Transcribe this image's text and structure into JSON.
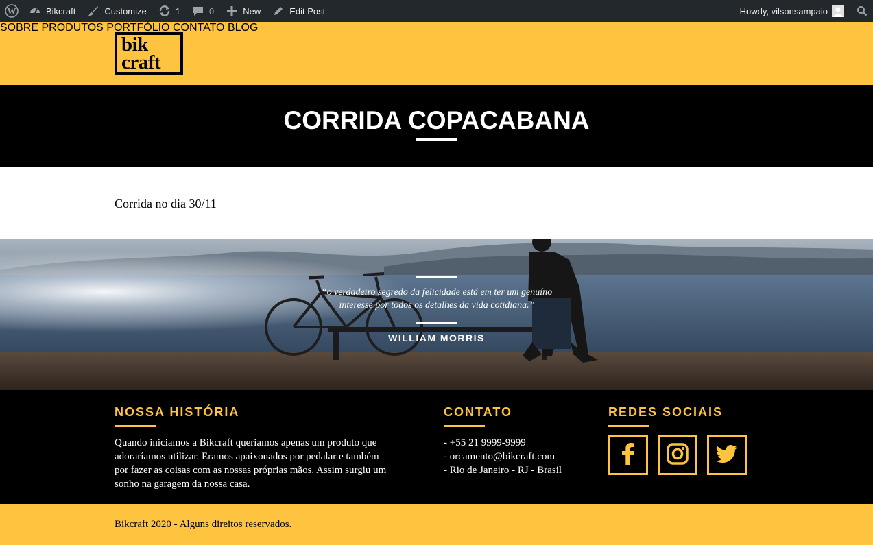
{
  "adminbar": {
    "site_name": "Bikcraft",
    "customize": "Customize",
    "updates_count": "1",
    "comments_count": "0",
    "new_label": "New",
    "edit_post": "Edit Post",
    "howdy": "Howdy, vilsonsampaio"
  },
  "header": {
    "logo_line1": "bik",
    "logo_line2": "craft",
    "nav": [
      "SOBRE",
      "PRODUTOS",
      "PORTFÓLIO",
      "CONTATO",
      "BLOG"
    ]
  },
  "page": {
    "title": "CORRIDA COPACABANA",
    "content": "Corrida no dia 30/11"
  },
  "quote": {
    "line1": "“o verdadeiro segredo da felicidade está em ter um genuíno",
    "line2": "interesse por todos os detalhes da vida cotidiana.”",
    "author": "WILLIAM MORRIS"
  },
  "footer": {
    "history_title": "NOSSA HISTÓRIA",
    "history_lines": [
      "Quando iniciamos a Bikcraft queriamos apenas um produto que",
      "adoraríamos utilizar. Eramos apaixonados por pedalar e também",
      "por fazer as coisas com as nossas próprias mãos. Assim surgiu um",
      "sonho na garagem da nossa casa."
    ],
    "contact_title": "CONTATO",
    "contact_lines": [
      "- +55 21 9999-9999",
      "- orcamento@bikcraft.com",
      "- Rio de Janeiro - RJ - Brasil"
    ],
    "social_title": "REDES SOCIAIS",
    "social_icons": [
      "facebook-icon",
      "instagram-icon",
      "twitter-icon"
    ],
    "copyright": "Bikcraft 2020 - Alguns direitos reservados."
  },
  "colors": {
    "brand_yellow": "#fec33f",
    "admin_bar": "#23282d",
    "black": "#000000"
  }
}
